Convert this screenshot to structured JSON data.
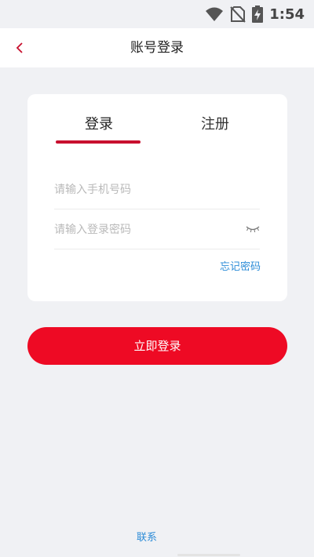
{
  "status_bar": {
    "time": "1:54",
    "icons": [
      "wifi-icon",
      "no-sim-icon",
      "battery-charging-icon"
    ]
  },
  "nav": {
    "title": "账号登录",
    "back_icon": "chevron-left-icon"
  },
  "tabs": {
    "login": "登录",
    "register": "注册",
    "active": "login"
  },
  "form": {
    "phone_placeholder": "请输入手机号码",
    "phone_value": "",
    "password_placeholder": "请输入登录密码",
    "password_value": "",
    "forgot_password": "忘记密码"
  },
  "login_button": "立即登录",
  "footer": {
    "link": "联系"
  },
  "colors": {
    "accent": "#ee0a24",
    "tab_underline": "#c8102e",
    "link": "#2d8cd7",
    "background": "#f0f1f4"
  }
}
